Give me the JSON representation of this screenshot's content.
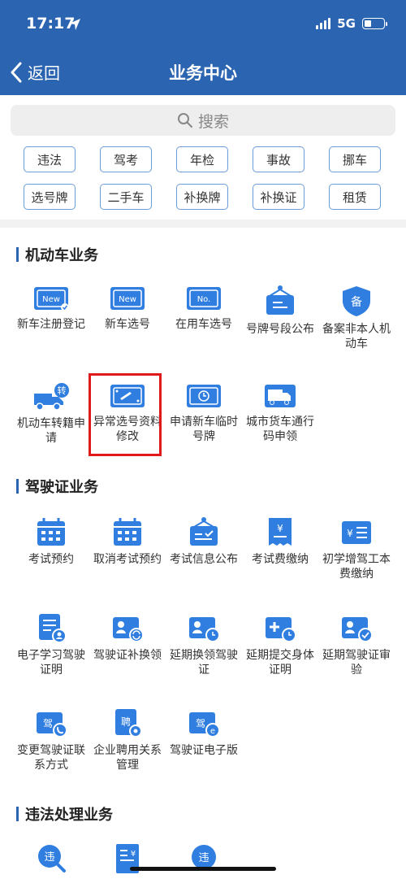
{
  "status": {
    "time": "17:17",
    "network": "5G"
  },
  "header": {
    "back_label": "返回",
    "title": "业务中心"
  },
  "search": {
    "placeholder": "搜索"
  },
  "quick_tags": [
    "违法",
    "驾考",
    "年检",
    "事故",
    "挪车",
    "选号牌",
    "二手车",
    "补换牌",
    "补换证",
    "租赁"
  ],
  "sections": {
    "vehicle": {
      "title": "机动车业务",
      "items": [
        "新车注册登记",
        "新车选号",
        "在用车选号",
        "号牌号段公布",
        "备案非本人机动车",
        "机动车转籍申请",
        "异常选号资料修改",
        "申请新车临时号牌",
        "城市货车通行码申领"
      ]
    },
    "license": {
      "title": "驾驶证业务",
      "items": [
        "考试预约",
        "取消考试预约",
        "考试信息公布",
        "考试费缴纳",
        "初学增驾工本费缴纳",
        "电子学习驾驶证明",
        "驾驶证补换领",
        "延期换领驾驶证",
        "延期提交身体证明",
        "延期驾驶证审验",
        "变更驾驶证联系方式",
        "企业聘用关系管理",
        "驾驶证电子版"
      ]
    },
    "violation": {
      "title": "违法处理业务"
    }
  },
  "icon_text": {
    "new": "New",
    "no": "No.",
    "zhuan": "转",
    "bei": "备",
    "jia": "驾",
    "pin": "聘",
    "wei": "违",
    "yen": "¥"
  },
  "colors": {
    "header": "#2b64b1",
    "icon_blue": "#2f7ee0",
    "chip_border": "#6b9bd8",
    "highlight": "#e01a1a"
  }
}
